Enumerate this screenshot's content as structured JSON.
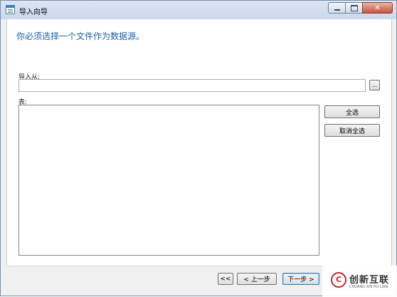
{
  "window": {
    "title": "导入向导"
  },
  "caption": {
    "minimize_icon": "minimize-icon",
    "maximize_icon": "maximize-icon",
    "close_icon": "close-icon",
    "close_glyph": "✕"
  },
  "wizard": {
    "heading": "你必须选择一个文件作为数据源。"
  },
  "source": {
    "label": "导入从:",
    "value": "",
    "placeholder": "",
    "browse_label": "..."
  },
  "tables": {
    "label": "表:",
    "items": []
  },
  "actions": {
    "select_all": "全选",
    "deselect_all": "取消全选"
  },
  "nav": {
    "first": "<<",
    "prev": "< 上一步",
    "next": "下一步 >"
  },
  "watermark": {
    "name": "创新互联",
    "sub": "CHUANG XIN HU LIAN",
    "logo_glyph": "C"
  }
}
